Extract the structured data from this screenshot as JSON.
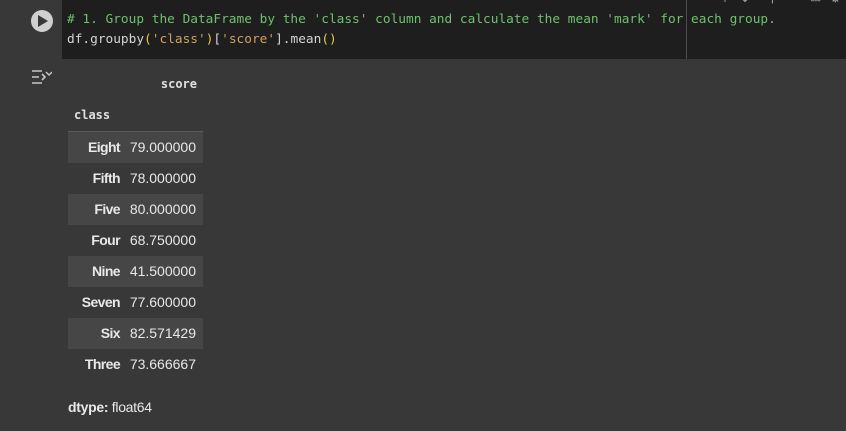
{
  "code_cell": {
    "comment": "# 1. Group the DataFrame by the 'class' column and calculate the mean 'mark' for each group.",
    "code_prefix": "df.groupby",
    "code_paren_open": "(",
    "code_arg1": "'class'",
    "code_paren_close": ")",
    "code_bracket_open": "[",
    "code_arg2": "'score'",
    "code_bracket_close": "]",
    "code_method": ".mean",
    "code_call": "()"
  },
  "output": {
    "column_header": "score",
    "index_name": "class",
    "rows": [
      {
        "label": "Eight",
        "value": "79.000000"
      },
      {
        "label": "Fifth",
        "value": "78.000000"
      },
      {
        "label": "Five",
        "value": "80.000000"
      },
      {
        "label": "Four",
        "value": "68.750000"
      },
      {
        "label": "Nine",
        "value": "41.500000"
      },
      {
        "label": "Seven",
        "value": "77.600000"
      },
      {
        "label": "Six",
        "value": "82.571429"
      },
      {
        "label": "Three",
        "value": "73.666667"
      }
    ],
    "dtype_label": "dtype:",
    "dtype_value": "float64"
  },
  "icons": {
    "run": "run-cell-icon",
    "output_menu": "output-actions-icon"
  },
  "colors": {
    "background": "#383838",
    "code_background": "#1e1e1e",
    "comment": "#6ec16a",
    "string": "#cfa15f",
    "text": "#e8e8e8"
  }
}
